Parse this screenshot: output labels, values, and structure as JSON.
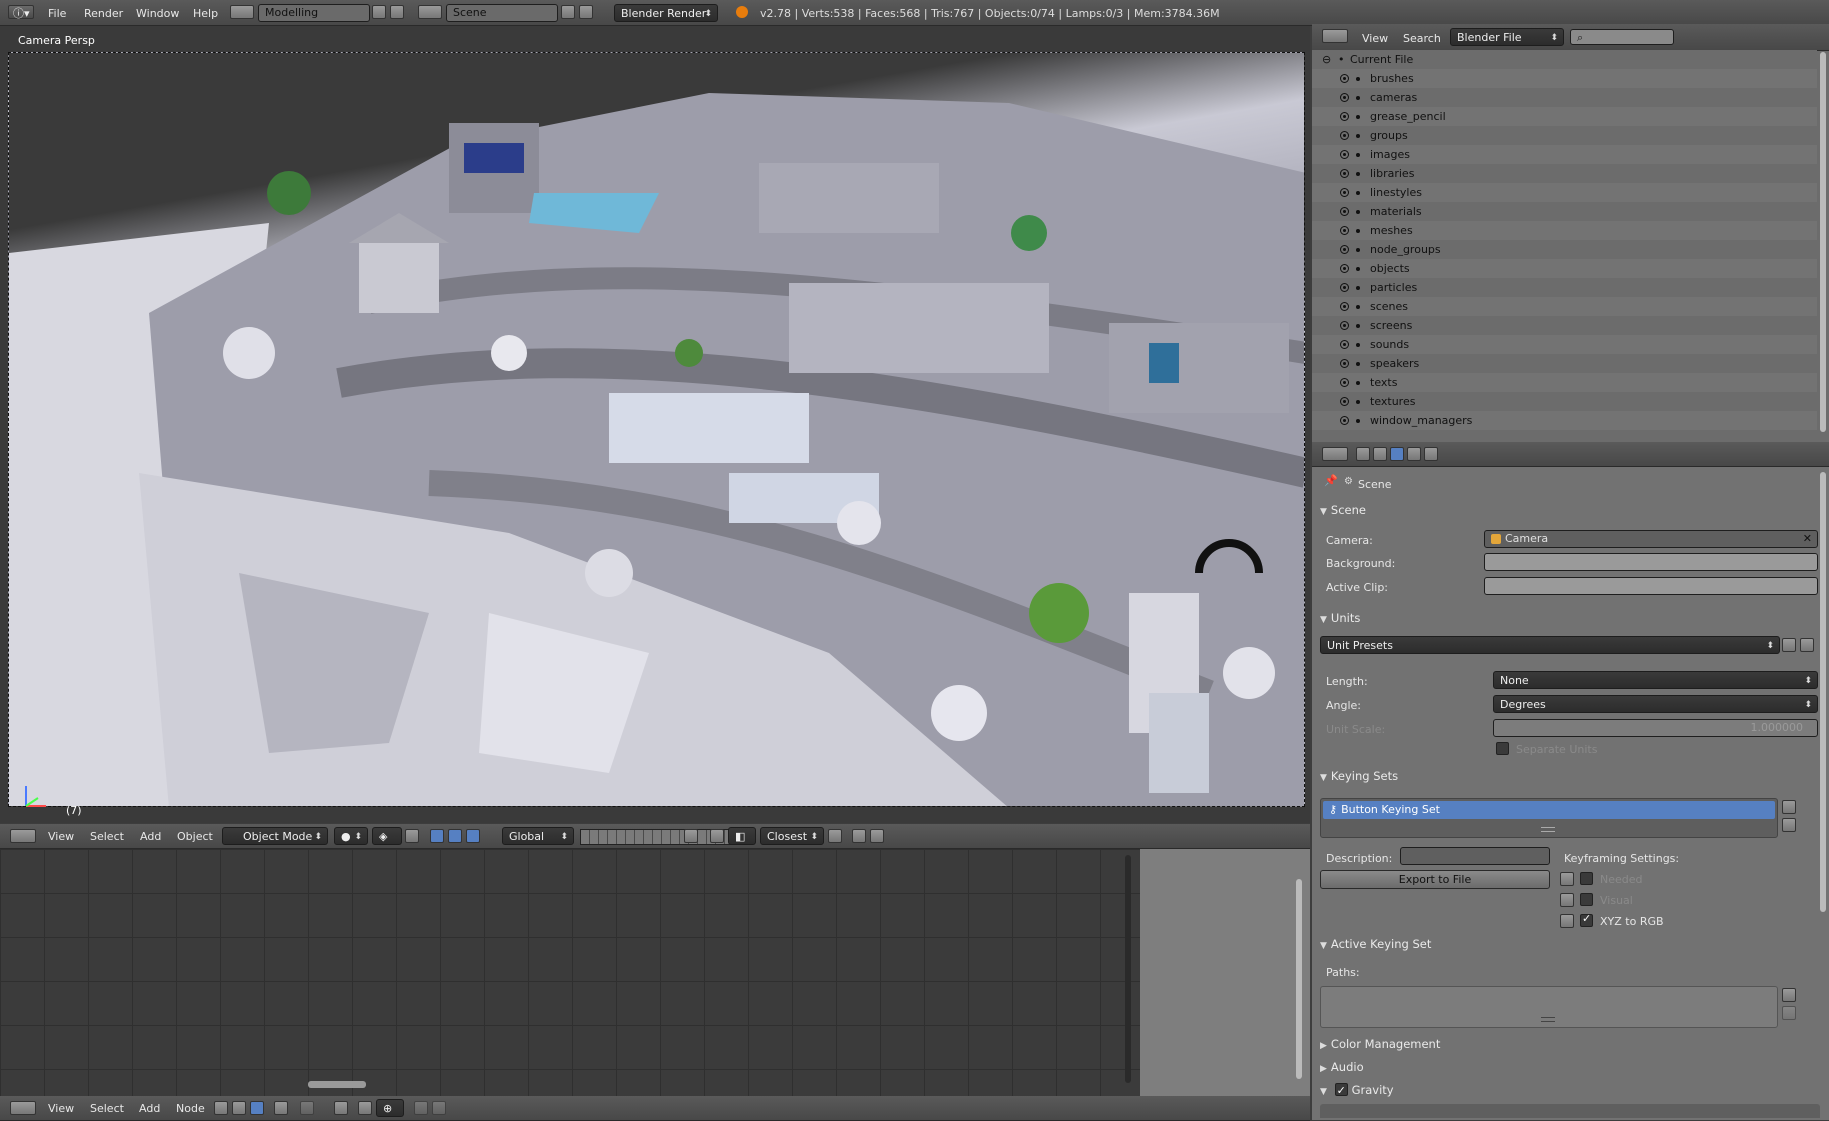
{
  "top_bar": {
    "menus": [
      "File",
      "Render",
      "Window",
      "Help"
    ],
    "screen_layout": "Modelling",
    "scene": "Scene",
    "render_engine": "Blender Render",
    "stats": "v2.78 | Verts:538 | Faces:568 | Tris:767 | Objects:0/74 | Lamps:0/3 | Mem:3784.36M"
  },
  "viewport": {
    "label": "Camera Persp",
    "frame": "(7)",
    "header": {
      "menus": [
        "View",
        "Select",
        "Add",
        "Object"
      ],
      "mode": "Object Mode",
      "orientation": "Global",
      "snap_target": "Closest"
    }
  },
  "node_editor": {
    "menus": [
      "View",
      "Select",
      "Add",
      "Node"
    ]
  },
  "outliner": {
    "menus": [
      "View",
      "Search"
    ],
    "display_mode": "Blender File",
    "root": "Current File",
    "items": [
      "brushes",
      "cameras",
      "grease_pencil",
      "groups",
      "images",
      "libraries",
      "linestyles",
      "materials",
      "meshes",
      "node_groups",
      "objects",
      "particles",
      "scenes",
      "screens",
      "sounds",
      "speakers",
      "texts",
      "textures",
      "window_managers"
    ]
  },
  "properties": {
    "context": "Scene",
    "scene_section": {
      "title": "Scene",
      "camera_label": "Camera:",
      "camera_value": "Camera",
      "background_label": "Background:",
      "active_clip_label": "Active Clip:"
    },
    "units_section": {
      "title": "Units",
      "presets": "Unit Presets",
      "length_label": "Length:",
      "length_value": "None",
      "angle_label": "Angle:",
      "angle_value": "Degrees",
      "unit_scale_label": "Unit Scale:",
      "unit_scale_value": "1.000000",
      "separate_units": "Separate Units"
    },
    "keying_sets_section": {
      "title": "Keying Sets",
      "active_item": "Button Keying Set",
      "description_label": "Description:",
      "export_button": "Export to File",
      "keyframing_settings": "Keyframing Settings:",
      "needed": "Needed",
      "visual": "Visual",
      "xyz_to_rgb": "XYZ to RGB"
    },
    "active_keying_set_section": {
      "title": "Active Keying Set",
      "paths_label": "Paths:"
    },
    "collapsed_sections": [
      "Color Management",
      "Audio"
    ],
    "gravity_section": {
      "title": "Gravity"
    }
  }
}
